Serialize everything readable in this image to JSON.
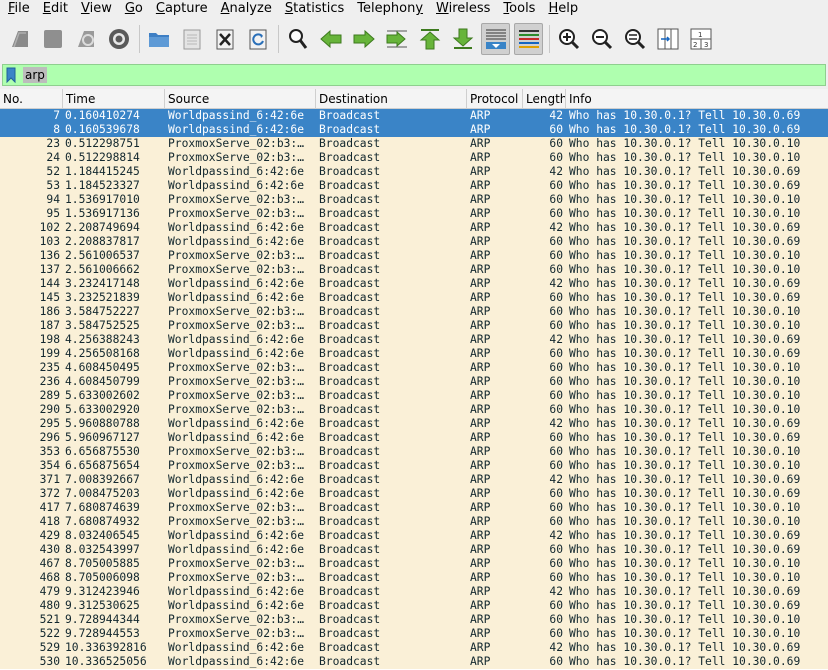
{
  "menu": [
    "File",
    "Edit",
    "View",
    "Go",
    "Capture",
    "Analyze",
    "Statistics",
    "Telephony",
    "Wireless",
    "Tools",
    "Help"
  ],
  "menu_underline": [
    "F",
    "E",
    "V",
    "G",
    "C",
    "A",
    "S",
    "y",
    "W",
    "T",
    "H"
  ],
  "filter": {
    "value": "arp"
  },
  "columns": [
    "No.",
    "Time",
    "Source",
    "Destination",
    "Protocol",
    "Length",
    "Info"
  ],
  "packets": [
    [
      "7",
      "0.160410274",
      "Worldpassind_6:42:6e",
      "Broadcast",
      "ARP",
      "42",
      "Who has 10.30.0.1? Tell 10.30.0.69"
    ],
    [
      "8",
      "0.160539678",
      "Worldpassind_6:42:6e",
      "Broadcast",
      "ARP",
      "60",
      "Who has 10.30.0.1? Tell 10.30.0.69"
    ],
    [
      "23",
      "0.512298751",
      "ProxmoxServe_02:b3:…",
      "Broadcast",
      "ARP",
      "60",
      "Who has 10.30.0.1? Tell 10.30.0.10"
    ],
    [
      "24",
      "0.512298814",
      "ProxmoxServe_02:b3:…",
      "Broadcast",
      "ARP",
      "60",
      "Who has 10.30.0.1? Tell 10.30.0.10"
    ],
    [
      "52",
      "1.184415245",
      "Worldpassind_6:42:6e",
      "Broadcast",
      "ARP",
      "42",
      "Who has 10.30.0.1? Tell 10.30.0.69"
    ],
    [
      "53",
      "1.184523327",
      "Worldpassind_6:42:6e",
      "Broadcast",
      "ARP",
      "60",
      "Who has 10.30.0.1? Tell 10.30.0.69"
    ],
    [
      "94",
      "1.536917010",
      "ProxmoxServe_02:b3:…",
      "Broadcast",
      "ARP",
      "60",
      "Who has 10.30.0.1? Tell 10.30.0.10"
    ],
    [
      "95",
      "1.536917136",
      "ProxmoxServe_02:b3:…",
      "Broadcast",
      "ARP",
      "60",
      "Who has 10.30.0.1? Tell 10.30.0.10"
    ],
    [
      "102",
      "2.208749694",
      "Worldpassind_6:42:6e",
      "Broadcast",
      "ARP",
      "42",
      "Who has 10.30.0.1? Tell 10.30.0.69"
    ],
    [
      "103",
      "2.208837817",
      "Worldpassind_6:42:6e",
      "Broadcast",
      "ARP",
      "60",
      "Who has 10.30.0.1? Tell 10.30.0.69"
    ],
    [
      "136",
      "2.561006537",
      "ProxmoxServe_02:b3:…",
      "Broadcast",
      "ARP",
      "60",
      "Who has 10.30.0.1? Tell 10.30.0.10"
    ],
    [
      "137",
      "2.561006662",
      "ProxmoxServe_02:b3:…",
      "Broadcast",
      "ARP",
      "60",
      "Who has 10.30.0.1? Tell 10.30.0.10"
    ],
    [
      "144",
      "3.232417148",
      "Worldpassind_6:42:6e",
      "Broadcast",
      "ARP",
      "42",
      "Who has 10.30.0.1? Tell 10.30.0.69"
    ],
    [
      "145",
      "3.232521839",
      "Worldpassind_6:42:6e",
      "Broadcast",
      "ARP",
      "60",
      "Who has 10.30.0.1? Tell 10.30.0.69"
    ],
    [
      "186",
      "3.584752227",
      "ProxmoxServe_02:b3:…",
      "Broadcast",
      "ARP",
      "60",
      "Who has 10.30.0.1? Tell 10.30.0.10"
    ],
    [
      "187",
      "3.584752525",
      "ProxmoxServe_02:b3:…",
      "Broadcast",
      "ARP",
      "60",
      "Who has 10.30.0.1? Tell 10.30.0.10"
    ],
    [
      "198",
      "4.256388243",
      "Worldpassind_6:42:6e",
      "Broadcast",
      "ARP",
      "42",
      "Who has 10.30.0.1? Tell 10.30.0.69"
    ],
    [
      "199",
      "4.256508168",
      "Worldpassind_6:42:6e",
      "Broadcast",
      "ARP",
      "60",
      "Who has 10.30.0.1? Tell 10.30.0.69"
    ],
    [
      "235",
      "4.608450495",
      "ProxmoxServe_02:b3:…",
      "Broadcast",
      "ARP",
      "60",
      "Who has 10.30.0.1? Tell 10.30.0.10"
    ],
    [
      "236",
      "4.608450799",
      "ProxmoxServe_02:b3:…",
      "Broadcast",
      "ARP",
      "60",
      "Who has 10.30.0.1? Tell 10.30.0.10"
    ],
    [
      "289",
      "5.633002602",
      "ProxmoxServe_02:b3:…",
      "Broadcast",
      "ARP",
      "60",
      "Who has 10.30.0.1? Tell 10.30.0.10"
    ],
    [
      "290",
      "5.633002920",
      "ProxmoxServe_02:b3:…",
      "Broadcast",
      "ARP",
      "60",
      "Who has 10.30.0.1? Tell 10.30.0.10"
    ],
    [
      "295",
      "5.960880788",
      "Worldpassind_6:42:6e",
      "Broadcast",
      "ARP",
      "42",
      "Who has 10.30.0.1? Tell 10.30.0.69"
    ],
    [
      "296",
      "5.960967127",
      "Worldpassind_6:42:6e",
      "Broadcast",
      "ARP",
      "60",
      "Who has 10.30.0.1? Tell 10.30.0.69"
    ],
    [
      "353",
      "6.656875530",
      "ProxmoxServe_02:b3:…",
      "Broadcast",
      "ARP",
      "60",
      "Who has 10.30.0.1? Tell 10.30.0.10"
    ],
    [
      "354",
      "6.656875654",
      "ProxmoxServe_02:b3:…",
      "Broadcast",
      "ARP",
      "60",
      "Who has 10.30.0.1? Tell 10.30.0.10"
    ],
    [
      "371",
      "7.008392667",
      "Worldpassind_6:42:6e",
      "Broadcast",
      "ARP",
      "42",
      "Who has 10.30.0.1? Tell 10.30.0.69"
    ],
    [
      "372",
      "7.008475203",
      "Worldpassind_6:42:6e",
      "Broadcast",
      "ARP",
      "60",
      "Who has 10.30.0.1? Tell 10.30.0.69"
    ],
    [
      "417",
      "7.680874639",
      "ProxmoxServe_02:b3:…",
      "Broadcast",
      "ARP",
      "60",
      "Who has 10.30.0.1? Tell 10.30.0.10"
    ],
    [
      "418",
      "7.680874932",
      "ProxmoxServe_02:b3:…",
      "Broadcast",
      "ARP",
      "60",
      "Who has 10.30.0.1? Tell 10.30.0.10"
    ],
    [
      "429",
      "8.032406545",
      "Worldpassind_6:42:6e",
      "Broadcast",
      "ARP",
      "42",
      "Who has 10.30.0.1? Tell 10.30.0.69"
    ],
    [
      "430",
      "8.032543997",
      "Worldpassind_6:42:6e",
      "Broadcast",
      "ARP",
      "60",
      "Who has 10.30.0.1? Tell 10.30.0.69"
    ],
    [
      "467",
      "8.705005885",
      "ProxmoxServe_02:b3:…",
      "Broadcast",
      "ARP",
      "60",
      "Who has 10.30.0.1? Tell 10.30.0.10"
    ],
    [
      "468",
      "8.705006098",
      "ProxmoxServe_02:b3:…",
      "Broadcast",
      "ARP",
      "60",
      "Who has 10.30.0.1? Tell 10.30.0.10"
    ],
    [
      "479",
      "9.312423946",
      "Worldpassind_6:42:6e",
      "Broadcast",
      "ARP",
      "42",
      "Who has 10.30.0.1? Tell 10.30.0.69"
    ],
    [
      "480",
      "9.312530625",
      "Worldpassind_6:42:6e",
      "Broadcast",
      "ARP",
      "60",
      "Who has 10.30.0.1? Tell 10.30.0.69"
    ],
    [
      "521",
      "9.728944344",
      "ProxmoxServe_02:b3:…",
      "Broadcast",
      "ARP",
      "60",
      "Who has 10.30.0.1? Tell 10.30.0.10"
    ],
    [
      "522",
      "9.728944553",
      "ProxmoxServe_02:b3:…",
      "Broadcast",
      "ARP",
      "60",
      "Who has 10.30.0.1? Tell 10.30.0.10"
    ],
    [
      "529",
      "10.336392816",
      "Worldpassind_6:42:6e",
      "Broadcast",
      "ARP",
      "42",
      "Who has 10.30.0.1? Tell 10.30.0.69"
    ],
    [
      "530",
      "10.336525056",
      "Worldpassind_6:42:6e",
      "Broadcast",
      "ARP",
      "60",
      "Who has 10.30.0.1? Tell 10.30.0.69"
    ]
  ],
  "selected_rows": [
    0,
    1
  ],
  "colors": {
    "row_bg": "#faf0d7",
    "row_fg": "#12272e",
    "selected_bg": "#3a84c7",
    "filter_valid_bg": "#afffaf"
  },
  "toolbar_icons": [
    "start-capture-icon",
    "stop-capture-icon",
    "restart-capture-icon",
    "capture-options-icon",
    "open-file-icon",
    "save-file-icon",
    "close-file-icon",
    "reload-file-icon",
    "find-packet-icon",
    "go-back-icon",
    "go-forward-icon",
    "go-to-packet-icon",
    "go-first-packet-icon",
    "go-last-packet-icon",
    "auto-scroll-icon",
    "colorize-icon",
    "zoom-in-icon",
    "zoom-out-icon",
    "zoom-normal-icon",
    "resize-columns-icon",
    "layout-icon"
  ]
}
